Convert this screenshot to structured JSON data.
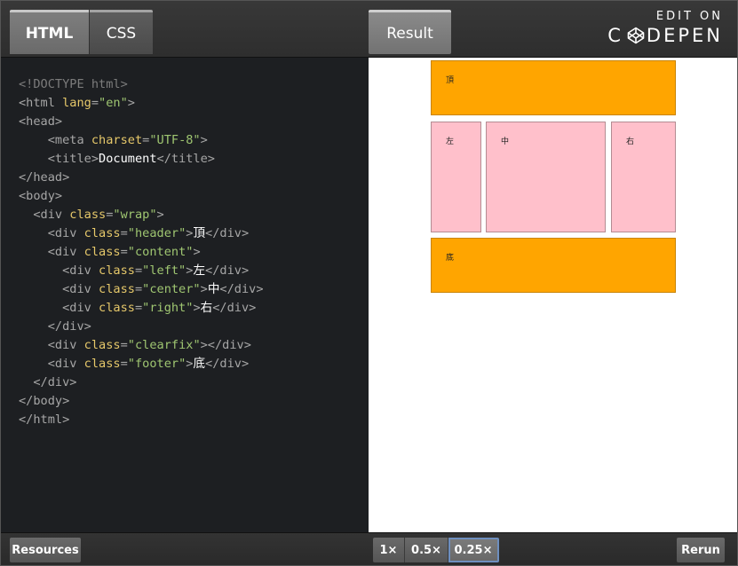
{
  "tabs": {
    "html": "HTML",
    "css": "CSS",
    "result": "Result"
  },
  "brand": {
    "edit_on": "EDIT ON",
    "codepen_prefix": "C",
    "codepen_suffix": "DEPEN"
  },
  "code": {
    "l1": "<!DOCTYPE html>",
    "l2_open": "<html ",
    "l2_attr": "lang",
    "l2_val": "\"en\"",
    "l2_close": ">",
    "l3": "<head>",
    "l4_open": "    <meta ",
    "l4_attr": "charset",
    "l4_val": "\"UTF-8\"",
    "l4_close": ">",
    "l5_open": "    <title>",
    "l5_text": "Document",
    "l5_close": "</title>",
    "l6": "</head>",
    "l7": "<body>",
    "l8_open": "  <div ",
    "l8_attr": "class",
    "l8_val": "\"wrap\"",
    "l8_close": ">",
    "l9_open": "    <div ",
    "l9_attr": "class",
    "l9_val": "\"header\"",
    "l9_mid": ">",
    "l9_text": "頂",
    "l9_close": "</div>",
    "l10_open": "    <div ",
    "l10_attr": "class",
    "l10_val": "\"content\"",
    "l10_close": ">",
    "l11_open": "      <div ",
    "l11_attr": "class",
    "l11_val": "\"left\"",
    "l11_mid": ">",
    "l11_text": "左",
    "l11_close": "</div>",
    "l12_open": "      <div ",
    "l12_attr": "class",
    "l12_val": "\"center\"",
    "l12_mid": ">",
    "l12_text": "中",
    "l12_close": "</div>",
    "l13_open": "      <div ",
    "l13_attr": "class",
    "l13_val": "\"right\"",
    "l13_mid": ">",
    "l13_text": "右",
    "l13_close": "</div>",
    "l14": "    </div>",
    "l15_open": "    <div ",
    "l15_attr": "class",
    "l15_val": "\"clearfix\"",
    "l15_close": "></div>",
    "l16_open": "    <div ",
    "l16_attr": "class",
    "l16_val": "\"footer\"",
    "l16_mid": ">",
    "l16_text": "底",
    "l16_close": "</div>",
    "l17": "  </div>",
    "l18": "</body>",
    "l19": "</html>"
  },
  "result_preview": {
    "header": "頂",
    "left": "左",
    "center": "中",
    "right": "右",
    "footer": "底",
    "colors": {
      "header_footer": "#ffa500",
      "columns": "#ffc0cb"
    }
  },
  "bottom": {
    "resources": "Resources",
    "zoom_1x": "1×",
    "zoom_05x": "0.5×",
    "zoom_025x": "0.25×",
    "zoom_selected": "0.25×",
    "rerun": "Rerun"
  }
}
